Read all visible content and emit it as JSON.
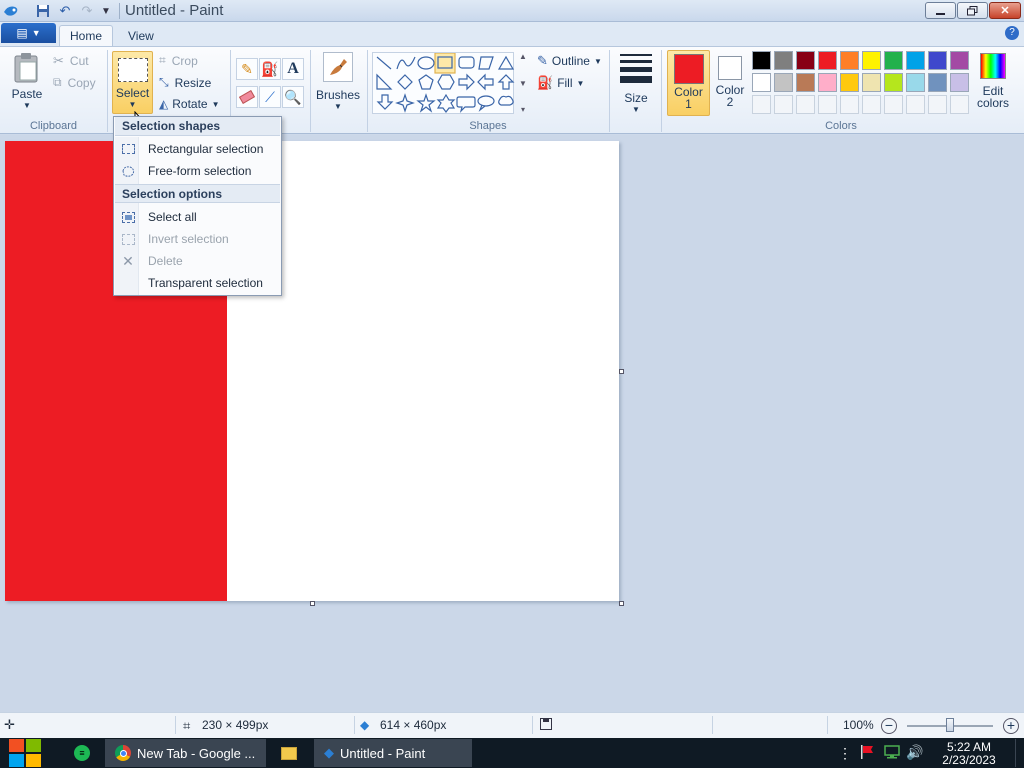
{
  "window": {
    "title": "Untitled - Paint",
    "controls": [
      "minimize",
      "restore",
      "close"
    ]
  },
  "ribbon_tabs": {
    "file": "File",
    "home": "Home",
    "view": "View"
  },
  "clipboard": {
    "paste": "Paste",
    "cut": "Cut",
    "copy": "Copy",
    "group_label": "Clipboard"
  },
  "image": {
    "select": "Select",
    "crop": "Crop",
    "resize": "Resize",
    "rotate": "Rotate"
  },
  "brushes": {
    "label": "Brushes"
  },
  "shapes": {
    "group_label": "Shapes",
    "outline": "Outline",
    "fill": "Fill"
  },
  "size": {
    "label": "Size"
  },
  "colors": {
    "color1_line1": "Color",
    "color1_line2": "1",
    "color2_line1": "Color",
    "color2_line2": "2",
    "edit_line1": "Edit",
    "edit_line2": "colors",
    "group_label": "Colors",
    "color1_value": "#ed1c24",
    "color2_value": "#ffffff",
    "palette_row1": [
      "#000000",
      "#7f7f7f",
      "#880015",
      "#ed1c24",
      "#ff7f27",
      "#fff200",
      "#22b14c",
      "#00a2e8",
      "#3f48cc",
      "#a349a4"
    ],
    "palette_row2": [
      "#ffffff",
      "#c3c3c3",
      "#b97a57",
      "#ffaec9",
      "#ffc90e",
      "#efe4b0",
      "#b5e61d",
      "#99d9ea",
      "#7092be",
      "#c8bfe7"
    ]
  },
  "select_menu": {
    "header_shapes": "Selection shapes",
    "rectangular": "Rectangular selection",
    "freeform": "Free-form selection",
    "header_options": "Selection options",
    "select_all": "Select all",
    "invert": "Invert selection",
    "delete": "Delete",
    "transparent": "Transparent selection"
  },
  "statusbar": {
    "selection_size": "230 × 499px",
    "canvas_size": "614 × 460px",
    "zoom": "100%",
    "zoom_level": 1.0
  },
  "taskbar": {
    "chrome": "New Tab - Google ...",
    "paint": "Untitled - Paint",
    "time": "5:22 AM",
    "date": "2/23/2023"
  }
}
